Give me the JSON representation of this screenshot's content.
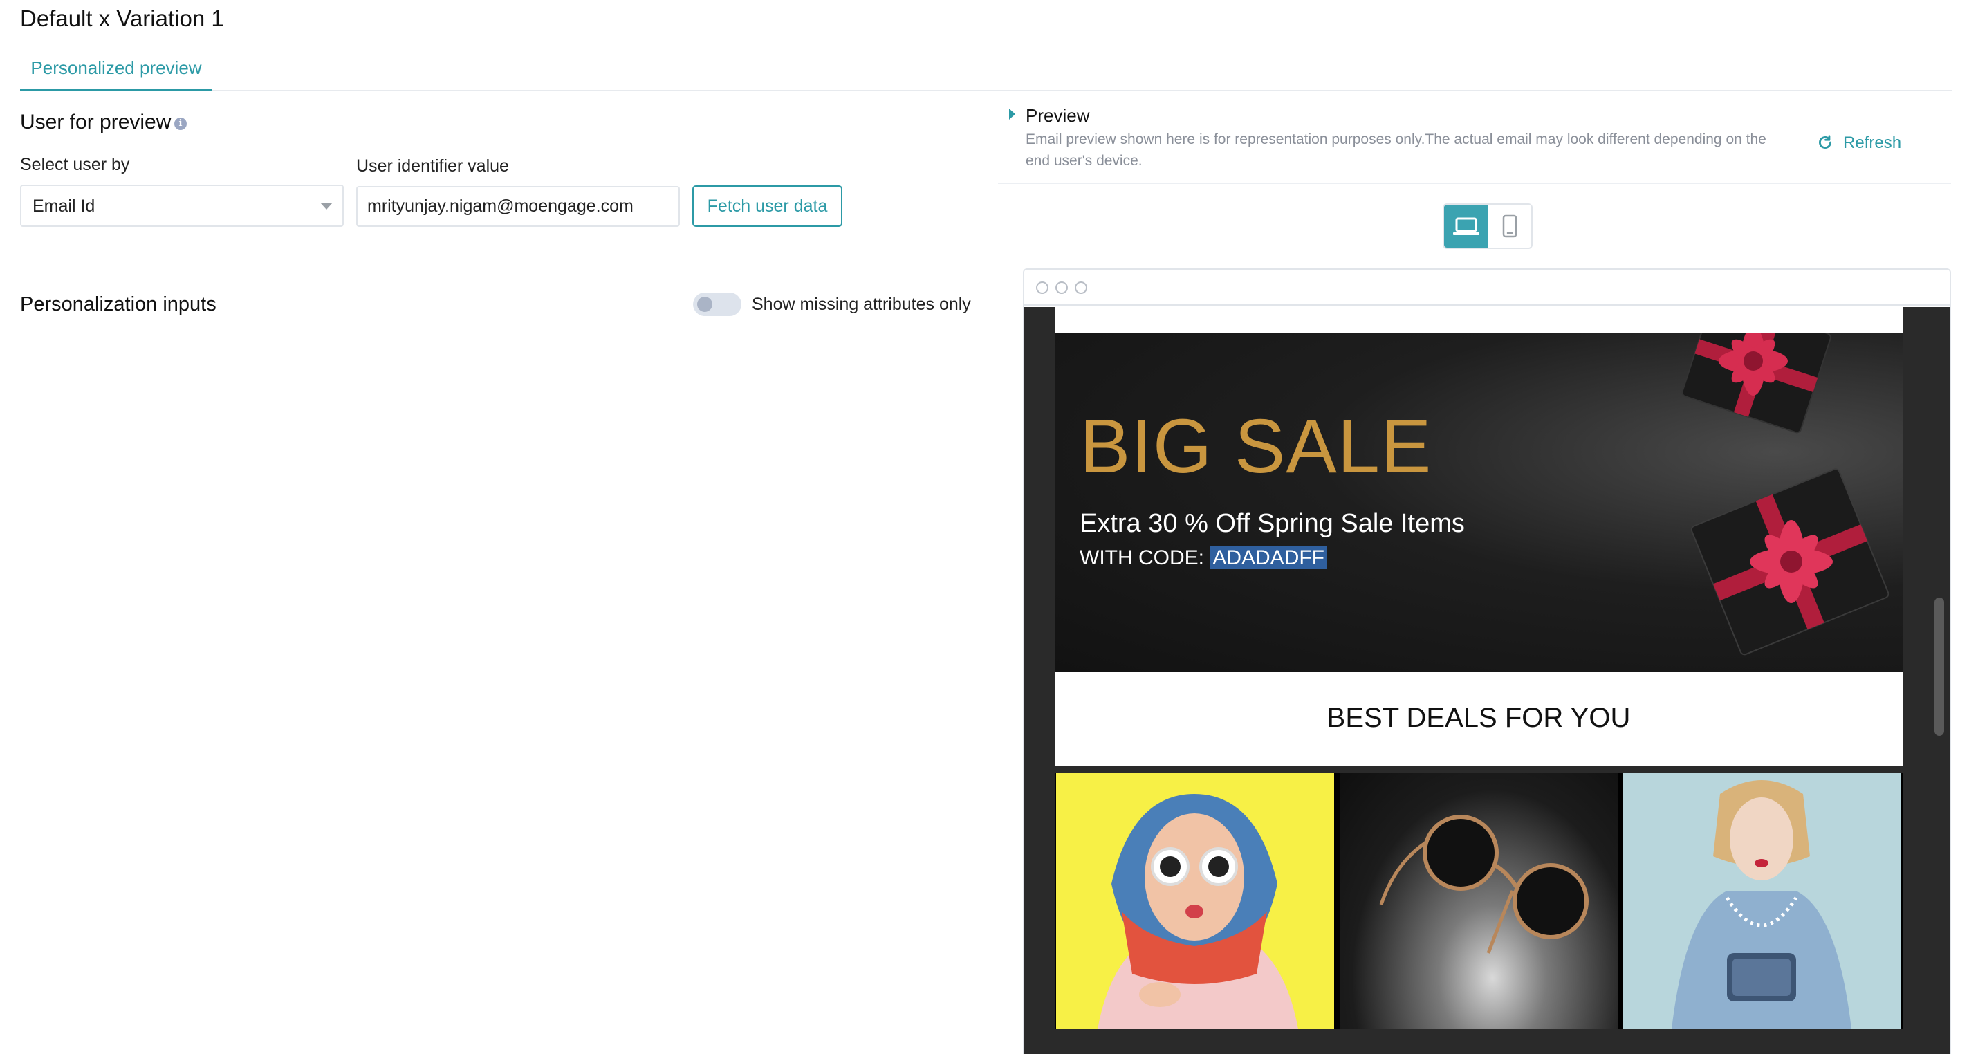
{
  "page_title": "Default x Variation 1",
  "tabs": [
    {
      "label": "Personalized preview",
      "active": true
    }
  ],
  "user_for_preview": {
    "title": "User for preview",
    "select_label": "Select user by",
    "select_value": "Email Id",
    "identifier_label": "User identifier value",
    "identifier_value": "mrityunjay.nigam@moengage.com",
    "fetch_button": "Fetch user data"
  },
  "personalization": {
    "title": "Personalization inputs",
    "toggle_label": "Show missing attributes only",
    "toggle_on": false
  },
  "preview": {
    "title": "Preview",
    "description": "Email preview shown here is for representation purposes only.The actual email may look different depending on the end user's device.",
    "refresh_label": "Refresh",
    "devices": [
      {
        "icon": "laptop-icon",
        "active": true
      },
      {
        "icon": "mobile-phone-icon",
        "active": false
      }
    ]
  },
  "email": {
    "hero_title": "BIG SALE",
    "hero_subtitle": "Extra 30 % Off Spring Sale Items",
    "code_prefix": "WITH CODE: ",
    "code_value": "ADADADFF",
    "deals_heading": "BEST DEALS FOR YOU",
    "products": [
      "woman-sunglasses-scarf-image",
      "round-sunglasses-image",
      "woman-denim-jacket-image"
    ]
  },
  "colors": {
    "accent": "#2c9aa6",
    "hero_gold": "#c9963f",
    "code_highlight": "#2f5f9e"
  }
}
